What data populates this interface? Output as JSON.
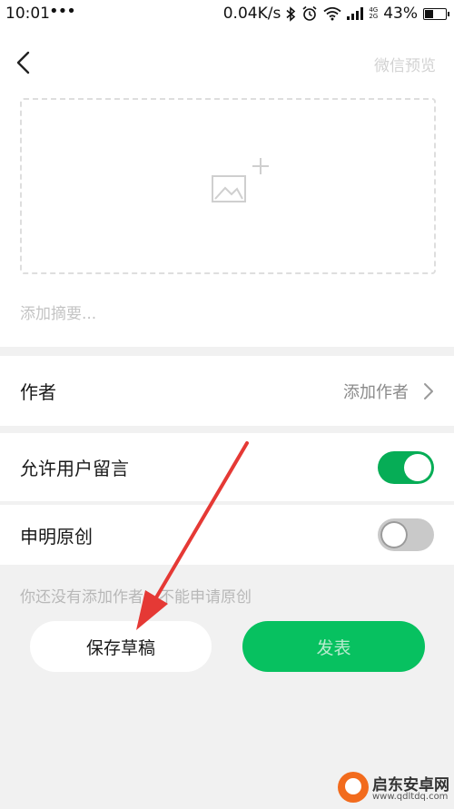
{
  "status_bar": {
    "time": "10:01",
    "dots": "•••",
    "speed": "0.04K/s",
    "network": [
      "4G",
      "2G"
    ],
    "battery": "43%",
    "battery_level": 0.43,
    "icons": [
      "bluetooth-icon",
      "alarm-icon",
      "wifi-icon",
      "signal-icon",
      "battery-icon"
    ]
  },
  "header": {
    "back_icon": "chevron-left-icon",
    "preview_label": "微信预览"
  },
  "cover": {
    "icon": "add-image-icon"
  },
  "summary": {
    "placeholder": "添加摘要..."
  },
  "settings": {
    "author": {
      "label": "作者",
      "value": "添加作者"
    },
    "allow_comments": {
      "label": "允许用户留言",
      "enabled": true
    },
    "original": {
      "label": "申明原创",
      "enabled": false
    }
  },
  "hint": "你还没有添加作者，不能申请原创",
  "actions": {
    "save_label": "保存草稿",
    "publish_label": "发表"
  },
  "watermark": {
    "name": "启东安卓网",
    "url": "www.qdltdq.com"
  },
  "colors": {
    "accent": "#07c160",
    "arrow": "#e53935"
  }
}
